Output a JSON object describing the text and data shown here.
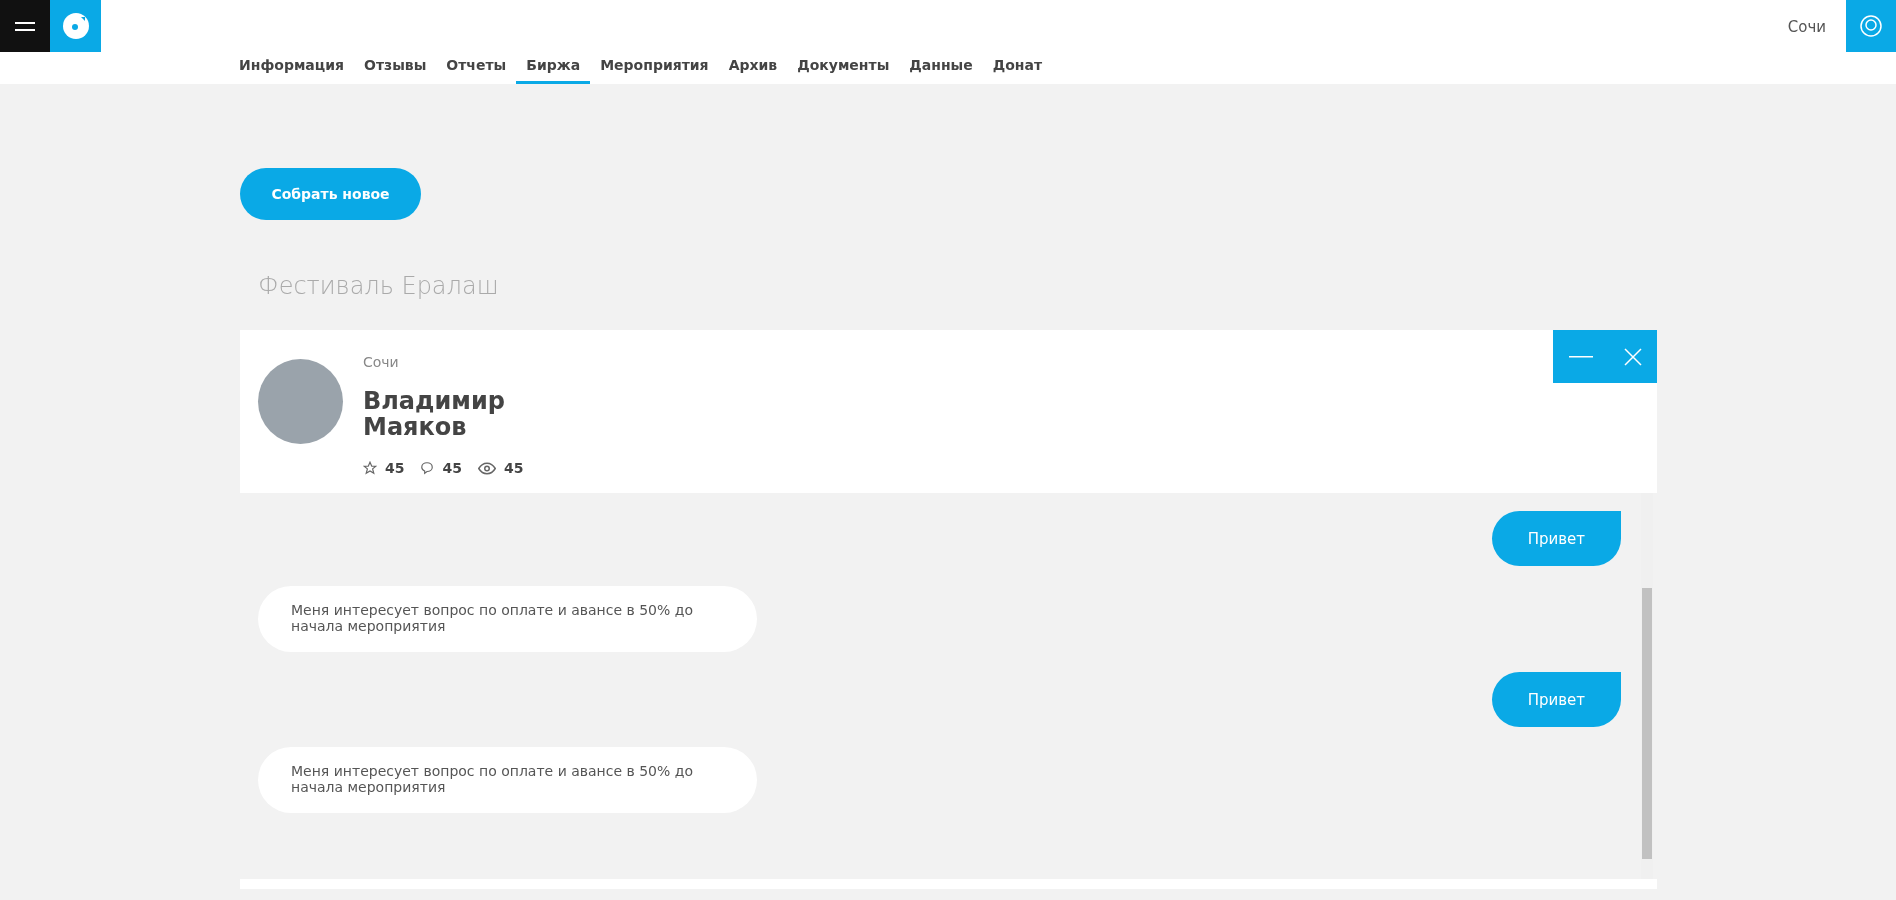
{
  "header": {
    "city": "Сочи"
  },
  "tabs": [
    {
      "label": "Информация",
      "selected": false
    },
    {
      "label": "Отзывы",
      "selected": false
    },
    {
      "label": "Отчеты",
      "selected": false
    },
    {
      "label": "Биржа",
      "selected": true
    },
    {
      "label": "Мероприятия",
      "selected": false
    },
    {
      "label": "Архив",
      "selected": false
    },
    {
      "label": "Документы",
      "selected": false
    },
    {
      "label": "Данные",
      "selected": false
    },
    {
      "label": "Донат",
      "selected": false
    }
  ],
  "create_button": "Собрать новое",
  "event_title": "Фестиваль Ералаш",
  "profile": {
    "city": "Сочи",
    "name": "Владимир Маяков",
    "stats": [
      {
        "kind": "star",
        "count": "45"
      },
      {
        "kind": "comment",
        "count": "45"
      },
      {
        "kind": "eye",
        "count": "45"
      }
    ]
  },
  "messages": [
    {
      "kind": "out",
      "text": "Привет"
    },
    {
      "kind": "in",
      "text": "Меня интересует вопрос по оплате и авансе в 50% до начала мероприятия"
    },
    {
      "kind": "out",
      "text": "Привет"
    },
    {
      "kind": "in",
      "text": "Меня интересует вопрос по оплате и авансе в 50% до начала мероприятия"
    }
  ]
}
